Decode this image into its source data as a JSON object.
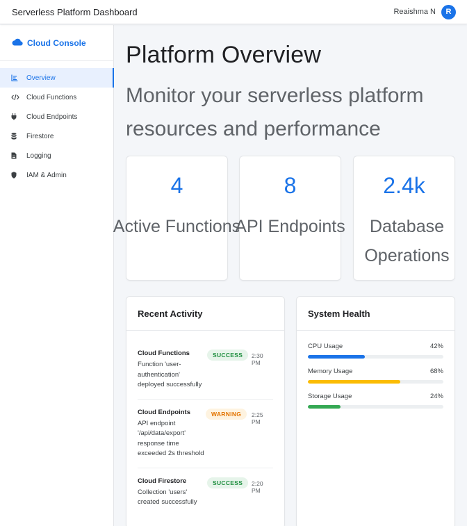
{
  "header": {
    "title": "Serverless Platform Dashboard",
    "user_name": "Reaishma N",
    "avatar_initial": "R"
  },
  "sidebar": {
    "brand": "Cloud Console",
    "items": [
      {
        "label": "Overview",
        "icon": "chart-icon",
        "active": true
      },
      {
        "label": "Cloud Functions",
        "icon": "code-icon",
        "active": false
      },
      {
        "label": "Cloud Endpoints",
        "icon": "plug-icon",
        "active": false
      },
      {
        "label": "Firestore",
        "icon": "database-icon",
        "active": false
      },
      {
        "label": "Logging",
        "icon": "document-icon",
        "active": false
      },
      {
        "label": "IAM & Admin",
        "icon": "shield-icon",
        "active": false
      }
    ]
  },
  "main": {
    "title": "Platform Overview",
    "subtitle": "Monitor your serverless platform resources and performance",
    "stats": [
      {
        "value": "4",
        "label": "Active Functions"
      },
      {
        "value": "8",
        "label": "API Endpoints"
      },
      {
        "value": "2.4k",
        "label": "Database Operations"
      }
    ],
    "recent_activity": {
      "title": "Recent Activity",
      "items": [
        {
          "service": "Cloud Functions",
          "message": "Function 'user-authentication' deployed successfully",
          "status": "SUCCESS",
          "time": "2:30 PM"
        },
        {
          "service": "Cloud Endpoints",
          "message": "API endpoint '/api/data/export' response time exceeded 2s threshold",
          "status": "WARNING",
          "time": "2:25 PM"
        },
        {
          "service": "Cloud Firestore",
          "message": "Collection 'users' created successfully",
          "status": "SUCCESS",
          "time": "2:20 PM"
        }
      ]
    },
    "system_health": {
      "title": "System Health",
      "metrics": [
        {
          "label": "CPU Usage",
          "value": "42%",
          "percent": 42,
          "color": "#1a73e8"
        },
        {
          "label": "Memory Usage",
          "value": "68%",
          "percent": 68,
          "color": "#fbbc04"
        },
        {
          "label": "Storage Usage",
          "value": "24%",
          "percent": 24,
          "color": "#34a853"
        }
      ]
    }
  },
  "colors": {
    "accent": "#1a73e8",
    "success": "#1e8e3e",
    "warning": "#e37400"
  }
}
